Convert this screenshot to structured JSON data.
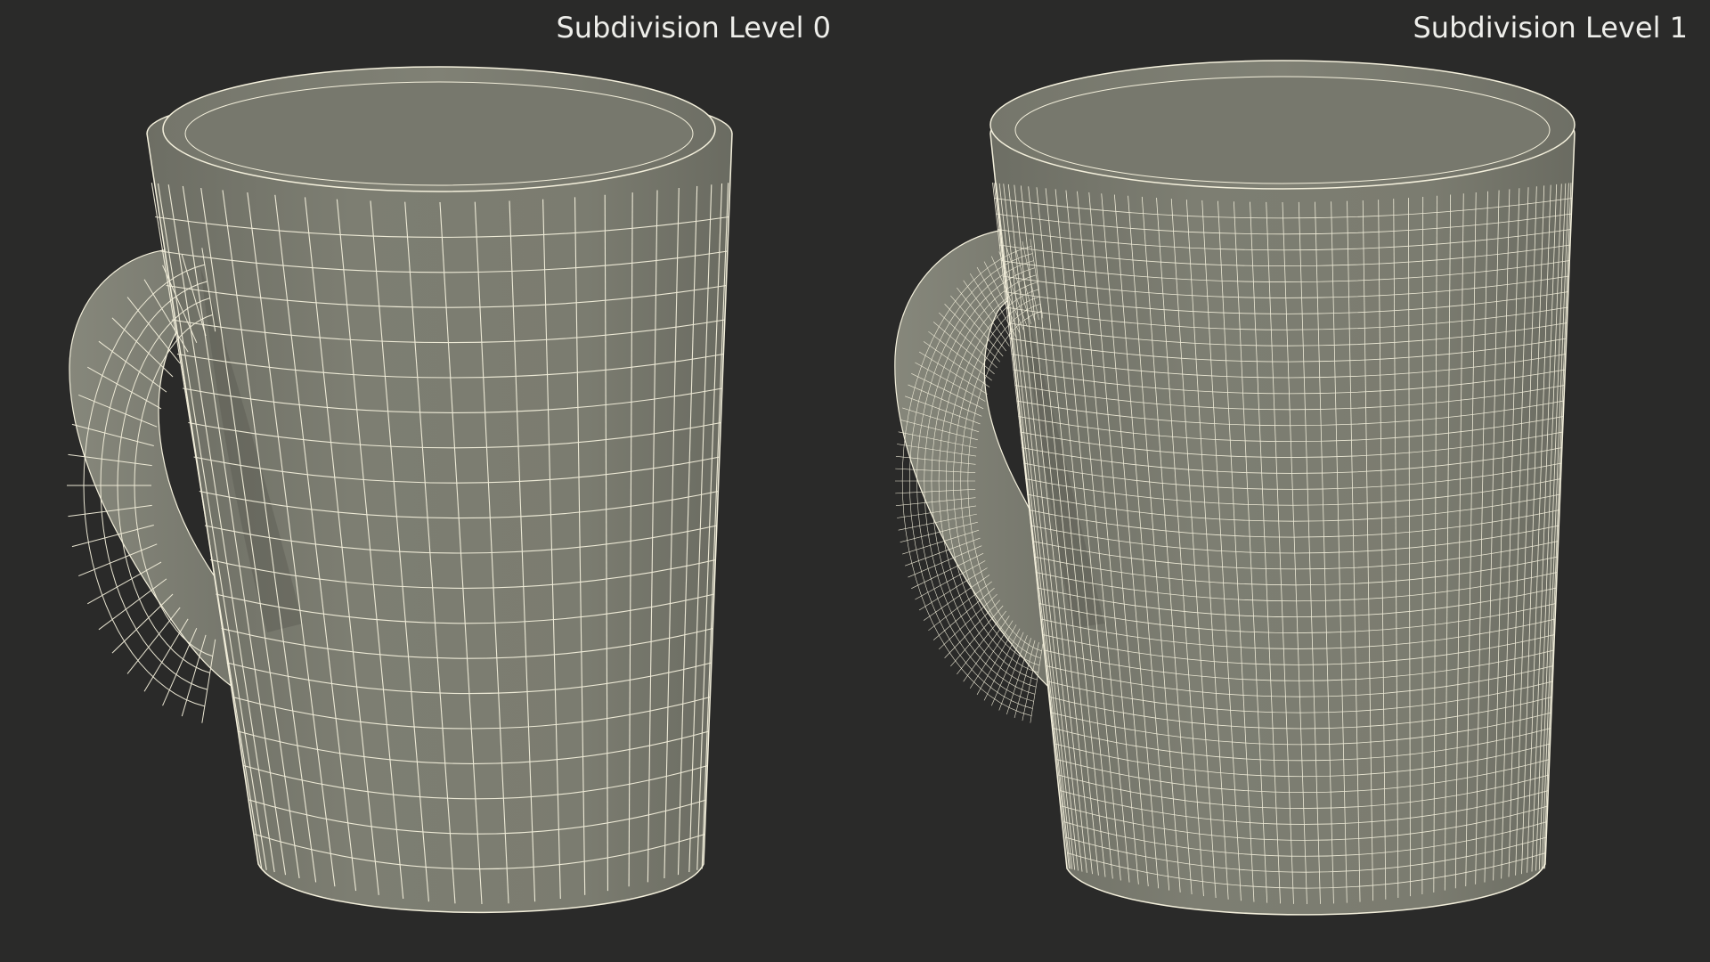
{
  "labels": {
    "left": "Subdivision Level 0",
    "right": "Subdivision Level 1"
  },
  "colors": {
    "background": "#2a2a29",
    "mesh_body": "#7a7a6e",
    "mesh_shadow": "#55564e",
    "wire": "#f4f0dc",
    "label_text": "#eeeeea"
  },
  "mugs": [
    {
      "name": "mug-subdivision-level-0",
      "subdivision_level": 0
    },
    {
      "name": "mug-subdivision-level-1",
      "subdivision_level": 1
    }
  ]
}
